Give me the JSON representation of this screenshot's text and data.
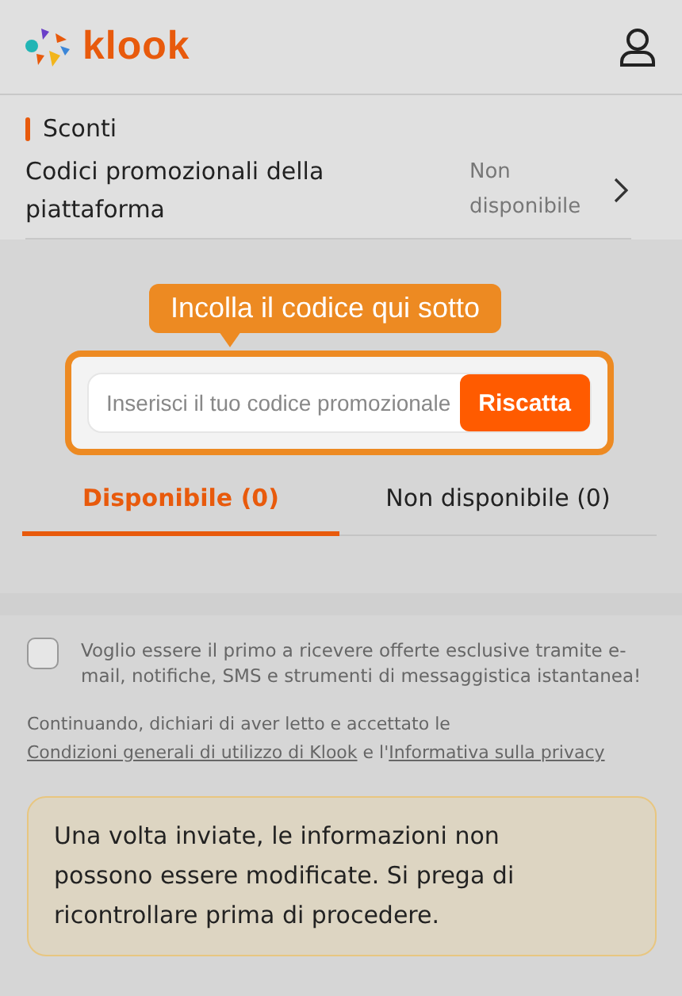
{
  "header": {
    "logo_text": "klook"
  },
  "discounts": {
    "title": "Sconti",
    "row": {
      "label": "Codici promozionali della piattaforma",
      "status": "Non disponibile"
    }
  },
  "promo": {
    "tooltip": "Incolla il codice qui sotto",
    "placeholder": "Inserisci il tuo codice promozionale",
    "button": "Riscatta"
  },
  "tabs": [
    {
      "label": "Disponibile (0)",
      "selected": true
    },
    {
      "label": "Non disponibile (0)",
      "selected": false
    }
  ],
  "consent": {
    "checked": false,
    "text": "Voglio essere il primo a ricevere offerte esclusive tramite e-mail, notifiche, SMS e strumenti di messaggistica istantanea!"
  },
  "legal": [
    {
      "kind": "text",
      "text": "Continuando, dichiari di aver letto e accettato le "
    },
    {
      "kind": "link",
      "text": "Condizioni "
    },
    {
      "kind": "link",
      "text": "generali di utilizzo di Klook"
    },
    {
      "kind": "text",
      "text": " e l'"
    },
    {
      "kind": "link",
      "text": "Informativa sulla privacy"
    }
  ],
  "notice": "Una volta inviate, le informazioni non possono essere modificate. Si prega di ricontrollare prima di procedere."
}
